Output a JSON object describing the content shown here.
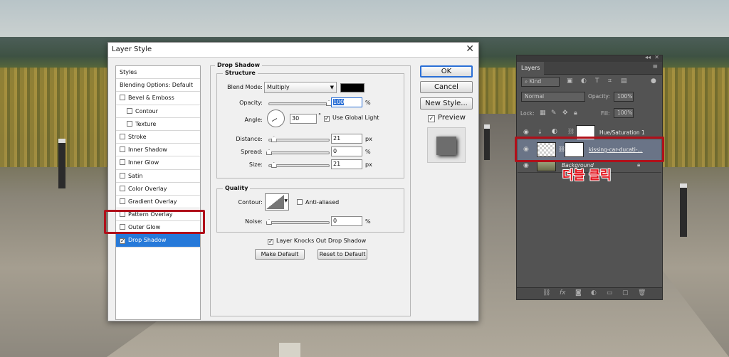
{
  "dialog": {
    "title": "Layer Style",
    "close_glyph": "✕",
    "styles_list": [
      {
        "label": "Styles",
        "type": "header"
      },
      {
        "label": "Blending Options: Default",
        "type": "header"
      },
      {
        "label": "Bevel & Emboss",
        "checked": false
      },
      {
        "label": "Contour",
        "checked": false,
        "sub": true
      },
      {
        "label": "Texture",
        "checked": false,
        "sub": true
      },
      {
        "label": "Stroke",
        "checked": false
      },
      {
        "label": "Inner Shadow",
        "checked": false
      },
      {
        "label": "Inner Glow",
        "checked": false
      },
      {
        "label": "Satin",
        "checked": false
      },
      {
        "label": "Color Overlay",
        "checked": false
      },
      {
        "label": "Gradient Overlay",
        "checked": false
      },
      {
        "label": "Pattern Overlay",
        "checked": false
      },
      {
        "label": "Outer Glow",
        "checked": false
      },
      {
        "label": "Drop Shadow",
        "checked": true,
        "selected": true
      }
    ],
    "section_title": "Drop Shadow",
    "structure": {
      "title": "Structure",
      "blend_mode_label": "Blend Mode:",
      "blend_mode_value": "Multiply",
      "shadow_color": "#000000",
      "opacity_label": "Opacity:",
      "opacity_value": "100",
      "opacity_unit": "%",
      "opacity_level": 1.0,
      "angle_label": "Angle:",
      "angle_value": "30",
      "angle_unit": "°",
      "use_global_light_label": "Use Global Light",
      "use_global_light": true,
      "distance_label": "Distance:",
      "distance_value": "21",
      "distance_unit": "px",
      "distance_level": 0.08,
      "spread_label": "Spread:",
      "spread_value": "0",
      "spread_unit": "%",
      "spread_level": 0.0,
      "size_label": "Size:",
      "size_value": "21",
      "size_unit": "px",
      "size_level": 0.08
    },
    "quality": {
      "title": "Quality",
      "contour_label": "Contour:",
      "anti_aliased_label": "Anti-aliased",
      "anti_aliased": false,
      "noise_label": "Noise:",
      "noise_value": "0",
      "noise_unit": "%",
      "noise_level": 0.0
    },
    "knockout_label": "Layer Knocks Out Drop Shadow",
    "knockout": true,
    "make_default_label": "Make Default",
    "reset_default_label": "Reset to Default",
    "ok_label": "OK",
    "cancel_label": "Cancel",
    "new_style_label": "New Style...",
    "preview_label": "Preview",
    "preview_checked": true
  },
  "layers_panel": {
    "tab_label": "Layers",
    "menu_glyph": "≡",
    "kind_label": "Kind",
    "blend_mode": "Normal",
    "opacity_label": "Opacity:",
    "opacity_value": "100%",
    "lock_label": "Lock:",
    "fill_label": "Fill:",
    "fill_value": "100%",
    "layers": [
      {
        "name": "Hue/Saturation 1",
        "active": false
      },
      {
        "name": "kissing-car-ducati-...",
        "active": true
      },
      {
        "name": "Background",
        "active": false
      }
    ]
  },
  "annotation": "더블 클릭",
  "colors": {
    "accent": "#2679d9",
    "highlight": "#b0101a"
  }
}
